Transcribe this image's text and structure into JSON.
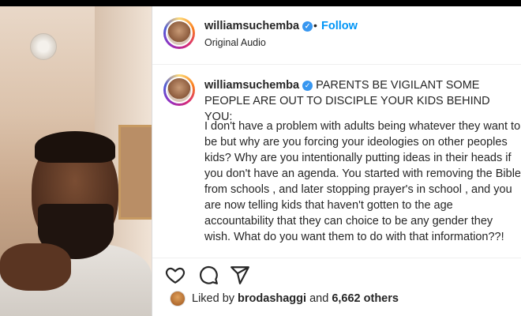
{
  "post": {
    "username": "williamsuchemba",
    "verified": true,
    "follow_label": "Follow",
    "separator": "•",
    "audio_label": "Original Audio"
  },
  "caption": {
    "username": "williamsuchemba",
    "headline": "PARENTS BE VIGILANT SOME PEOPLE ARE OUT TO DISCIPLE YOUR KIDS BEHIND YOU:",
    "body": "I don't have a problem with adults being whatever they want to be but why are you forcing your ideologies on other peoples kids? Why are you intentionally putting ideas in their heads if you don't have an agenda. You started with removing the Bible from schools , and later stopping prayer's in school , and you are now telling kids that haven't gotten to the age accountability that they can choice to be any gender they wish. What do you want them to do with that information??!"
  },
  "actions": {
    "like_icon": "heart-icon",
    "comment_icon": "comment-icon",
    "share_icon": "send-icon"
  },
  "likes": {
    "prefix": "Liked by",
    "user": "brodashaggi",
    "conjunction": "and",
    "others": "6,662 others"
  },
  "colors": {
    "accent": "#0095f6",
    "verified": "#3897f0",
    "text": "#262626"
  }
}
